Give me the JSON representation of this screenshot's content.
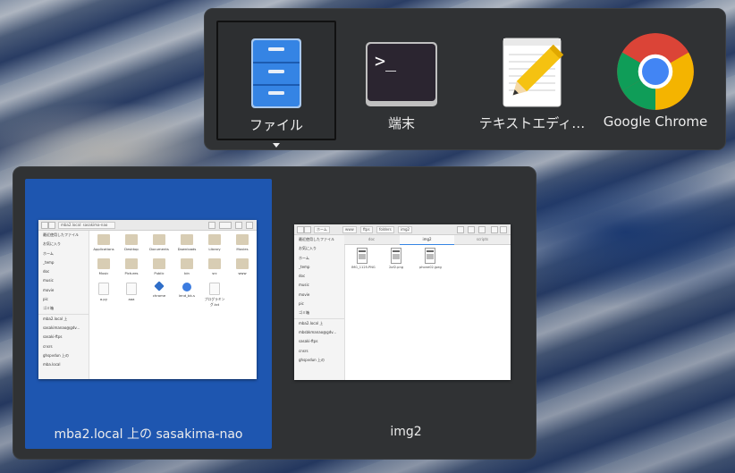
{
  "app_switcher": {
    "apps": [
      {
        "label": "ファイル",
        "icon": "file-cabinet-icon",
        "selected": true
      },
      {
        "label": "端末",
        "icon": "terminal-icon",
        "selected": false
      },
      {
        "label": "テキストエディ…",
        "icon": "text-editor-icon",
        "selected": false
      },
      {
        "label": "Google Chrome",
        "icon": "chrome-icon",
        "selected": false
      }
    ],
    "terminal_prompt": ">_"
  },
  "window_switcher": {
    "windows": [
      {
        "label": "mba2.local 上の sasakima-nao",
        "selected": true,
        "thumbnail": {
          "path": "mba2.local: sasakima-nao",
          "sidebar": [
            "最近使用したファイル",
            "お気に入り",
            "ホーム",
            "_temp",
            "doc",
            "music",
            "movie",
            "pic",
            "ゴミ箱",
            "mba2.local 上",
            "sasakimanao@gdv...",
            "sasaki-ftps",
            "cnsrs",
            "ghspvdun 上の",
            "mba.local"
          ],
          "files": [
            "Applications",
            "Desktop",
            "Documents",
            "Downloads",
            "Library",
            "Movies",
            "Music",
            "Pictures",
            "Public",
            "bin",
            "src",
            "www",
            "a.py",
            "aaa",
            "chrome",
            "lend_bk-s",
            "プログラミング.txt"
          ]
        }
      },
      {
        "label": "img2",
        "selected": false,
        "thumbnail": {
          "path": [
            "ホーム",
            "www",
            "ftps",
            "folders",
            "img2"
          ],
          "tabs": [
            "doc",
            "img2",
            "scripts"
          ],
          "sidebar": [
            "最近使用したファイル",
            "お気に入り",
            "ホーム",
            "_temp",
            "doc",
            "music",
            "movie",
            "pic",
            "ゴミ箱",
            "mba2.local 上",
            "mbsbkmanao@gdv...",
            "sasaki-ftps",
            "cnsrs",
            "ghspvdun 上の"
          ],
          "files": [
            "IMG_1125.PNG",
            "2of2.png",
            "phone02.jpeg"
          ]
        }
      }
    ]
  }
}
